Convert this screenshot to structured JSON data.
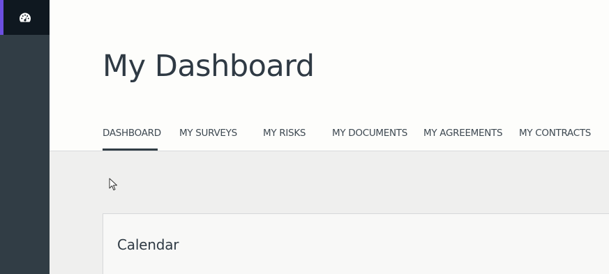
{
  "sidebar": {
    "items": [
      {
        "icon": "dashboard-gauge-icon",
        "active": true
      }
    ],
    "colors": {
      "background": "#313d45",
      "active_background": "#0f1820",
      "accent": "#6c4fe0"
    }
  },
  "header": {
    "title": "My Dashboard"
  },
  "tabs": [
    {
      "label": "DASHBOARD",
      "active": true
    },
    {
      "label": "MY SURVEYS",
      "active": false
    },
    {
      "label": "MY RISKS",
      "active": false
    },
    {
      "label": "MY DOCUMENTS",
      "active": false
    },
    {
      "label": "MY AGREEMENTS",
      "active": false
    },
    {
      "label": "MY CONTRACTS",
      "active": false
    }
  ],
  "content": {
    "card": {
      "title": "Calendar"
    }
  }
}
